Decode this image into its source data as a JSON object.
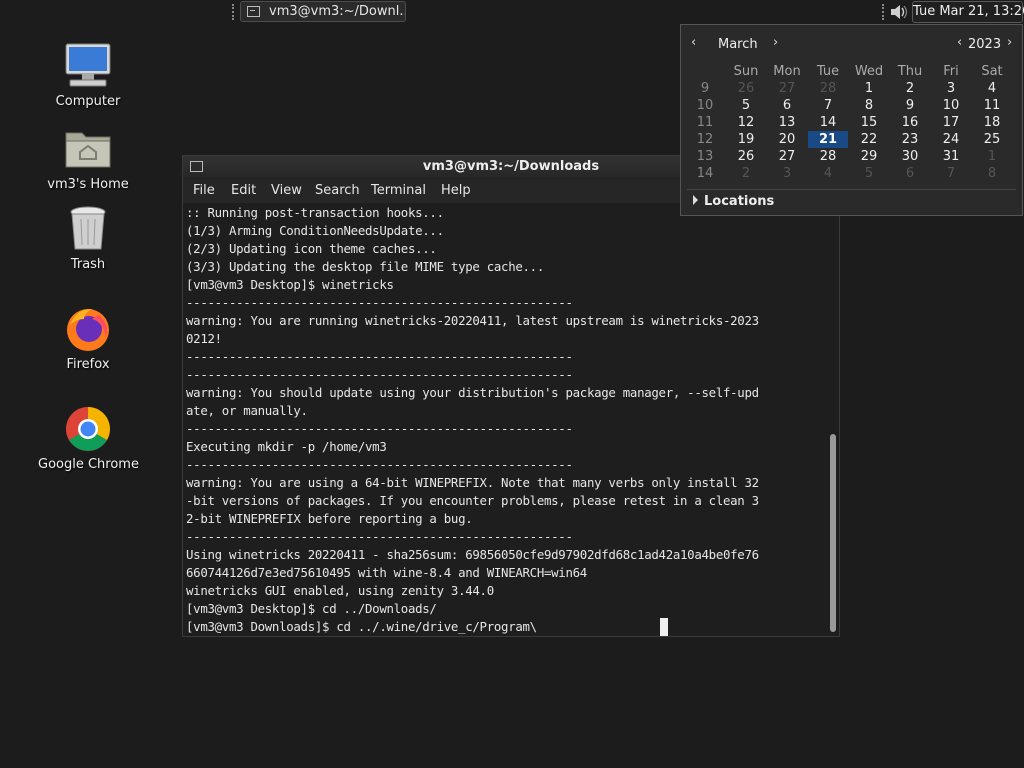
{
  "taskbar": {
    "window_button_label": "vm3@vm3:~/Downl..."
  },
  "clock": {
    "label": "Tue Mar 21, 13:26"
  },
  "desktop_icons": [
    {
      "label": "Computer",
      "icon": "computer-icon"
    },
    {
      "label": "vm3's Home",
      "icon": "home-folder-icon"
    },
    {
      "label": "Trash",
      "icon": "trash-icon"
    },
    {
      "label": "Firefox",
      "icon": "firefox-icon"
    },
    {
      "label": "Google Chrome",
      "icon": "chrome-icon"
    }
  ],
  "terminal": {
    "title": "vm3@vm3:~/Downloads",
    "menu": [
      "File",
      "Edit",
      "View",
      "Search",
      "Terminal",
      "Help"
    ],
    "lines": [
      ":: Running post-transaction hooks...",
      "(1/3) Arming ConditionNeedsUpdate...",
      "(2/3) Updating icon theme caches...",
      "(3/3) Updating the desktop file MIME type cache...",
      "[vm3@vm3 Desktop]$ winetricks",
      "------------------------------------------------------",
      "warning: You are running winetricks-20220411, latest upstream is winetricks-2023",
      "0212!",
      "------------------------------------------------------",
      "------------------------------------------------------",
      "warning: You should update using your distribution's package manager, --self-upd",
      "ate, or manually.",
      "------------------------------------------------------",
      "Executing mkdir -p /home/vm3",
      "------------------------------------------------------",
      "warning: You are using a 64-bit WINEPREFIX. Note that many verbs only install 32",
      "-bit versions of packages. If you encounter problems, please retest in a clean 3",
      "2-bit WINEPREFIX before reporting a bug.",
      "------------------------------------------------------",
      "Using winetricks 20220411 - sha256sum: 69856050cfe9d97902dfd68c1ad42a10a4be0fe76",
      "660744126d7e3ed75610495 with wine-8.4 and WINEARCH=win64",
      "winetricks GUI enabled, using zenity 3.44.0",
      "[vm3@vm3 Desktop]$ cd ../Downloads/",
      "[vm3@vm3 Downloads]$ cd ../.wine/drive_c/Program\\"
    ]
  },
  "calendar": {
    "month": "March",
    "year": "2023",
    "weekday_headers": [
      "Sun",
      "Mon",
      "Tue",
      "Wed",
      "Thu",
      "Fri",
      "Sat"
    ],
    "weeks": [
      {
        "week": "9",
        "days": [
          "26",
          "27",
          "28",
          "1",
          "2",
          "3",
          "4"
        ]
      },
      {
        "week": "10",
        "days": [
          "5",
          "6",
          "7",
          "8",
          "9",
          "10",
          "11"
        ]
      },
      {
        "week": "11",
        "days": [
          "12",
          "13",
          "14",
          "15",
          "16",
          "17",
          "18"
        ]
      },
      {
        "week": "12",
        "days": [
          "19",
          "20",
          "21",
          "22",
          "23",
          "24",
          "25"
        ]
      },
      {
        "week": "13",
        "days": [
          "26",
          "27",
          "28",
          "29",
          "30",
          "31",
          "1"
        ]
      },
      {
        "week": "14",
        "days": [
          "2",
          "3",
          "4",
          "5",
          "6",
          "7",
          "8"
        ]
      }
    ],
    "today": "21",
    "locations_label": "Locations"
  }
}
